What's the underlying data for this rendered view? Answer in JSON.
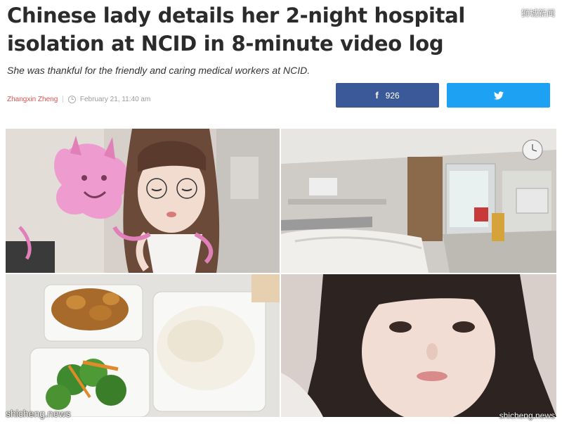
{
  "article": {
    "title": "Chinese lady details her 2-night hospital isolation at NCID in 8-minute video log",
    "subtitle": "She was thankful for the friendly and caring medical workers at NCID.",
    "author": "Zhangxin Zheng",
    "separator": "|",
    "date": "February 21, 11:40 am"
  },
  "share": {
    "facebook_glyph": "f",
    "facebook_count": "926",
    "facebook_icon": "facebook-icon",
    "twitter_icon": "twitter-bird-icon"
  },
  "watermarks": {
    "bottom_left": "shicheng.news",
    "bottom_right": "shicheng.news",
    "top_right": "狮城新闻"
  },
  "colors": {
    "author": "#d9534f",
    "facebook": "#3b5998",
    "twitter": "#1da1f2",
    "headline": "#2b2b2b"
  }
}
